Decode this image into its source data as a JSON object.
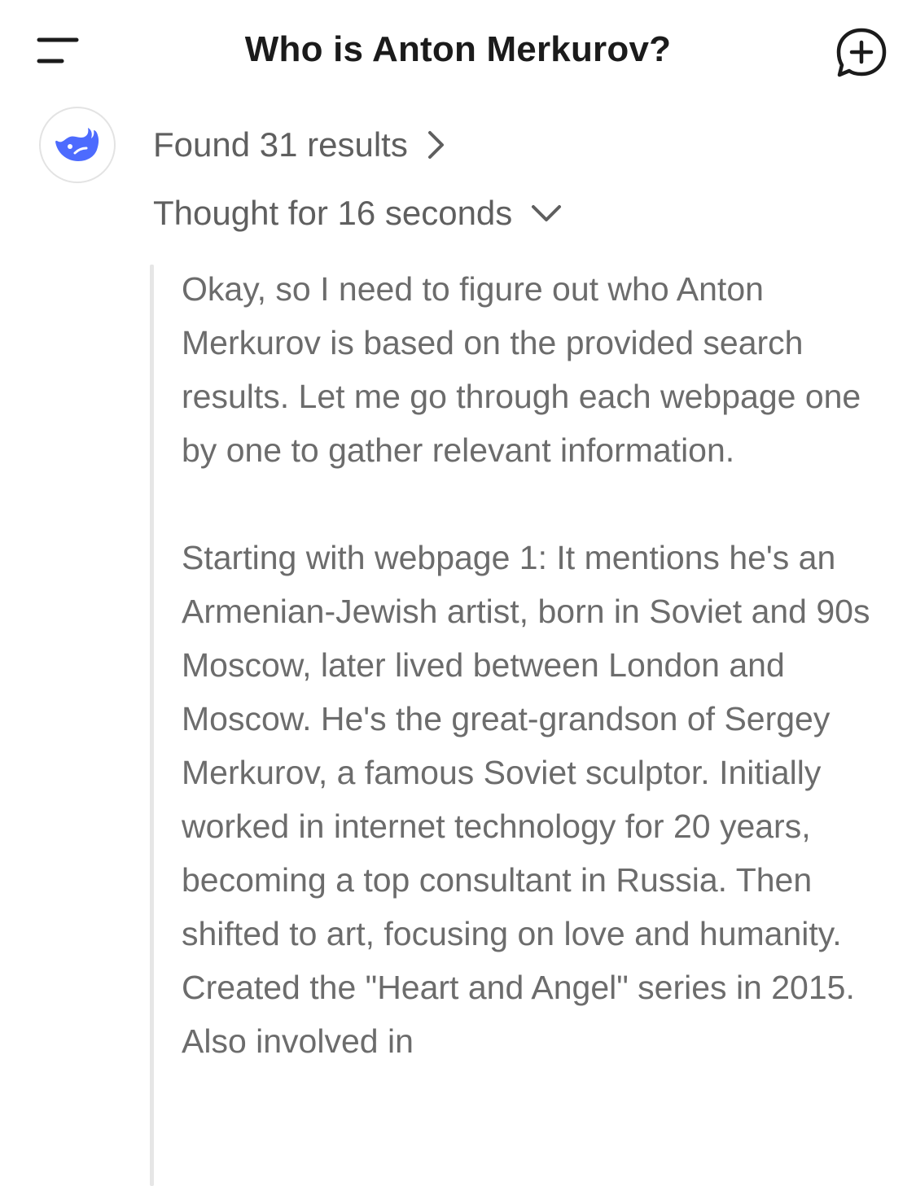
{
  "header": {
    "title": "Who is Anton Merkurov?",
    "menu_icon": "menu-icon",
    "new_chat_icon": "new-chat-icon"
  },
  "assistant": {
    "avatar_icon": "whale-logo-icon",
    "brand_color": "#4D6BFE"
  },
  "search": {
    "label": "Found 31 results",
    "icon": "chevron-right-icon"
  },
  "thought": {
    "label": "Thought for 16 seconds",
    "icon": "chevron-down-icon"
  },
  "reasoning": {
    "paragraphs": [
      "Okay, so I need to figure out who Anton Merkurov is based on the provided search results. Let me go through each webpage one by one to gather relevant information.",
      "Starting with webpage 1: It mentions he's an Armenian-Jewish artist, born in Soviet and 90s Moscow, later lived between London and Moscow. He's the great-grandson of Sergey Merkurov, a famous Soviet sculptor. Initially worked in internet technology for 20 years, becoming a top consultant in Russia. Then shifted to art, focusing on love and humanity. Created the \"Heart and Angel\" series in 2015. Also involved in"
    ]
  }
}
